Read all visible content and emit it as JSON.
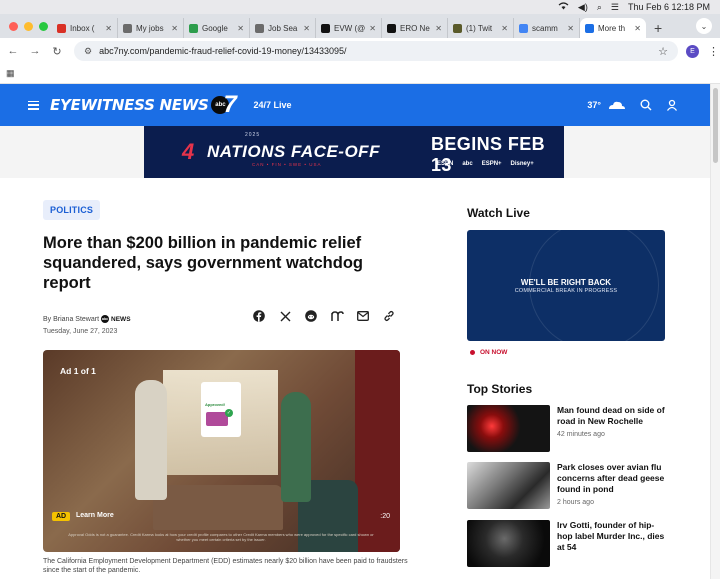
{
  "os_menubar": {
    "datetime": "Thu Feb 6  12:18 PM"
  },
  "browser": {
    "tabs": [
      {
        "label": "Inbox (",
        "favicon": "gmail-icon",
        "color": "#d93025"
      },
      {
        "label": "My jobs",
        "favicon": "job-icon",
        "color": "#6b6b6b"
      },
      {
        "label": "Google",
        "favicon": "google-docs-icon",
        "color": "#2d9d4c"
      },
      {
        "label": "Job Sea",
        "favicon": "job-icon",
        "color": "#6b6b6b"
      },
      {
        "label": "EVW (@",
        "favicon": "x-icon",
        "color": "#111111"
      },
      {
        "label": "ERO Ne",
        "favicon": "x-icon",
        "color": "#111111"
      },
      {
        "label": "(1) Twit",
        "favicon": "twitter-icon",
        "color": "#5a5a2a"
      },
      {
        "label": "scamm",
        "favicon": "google-icon",
        "color": "#4285f4"
      },
      {
        "label": "More th",
        "favicon": "abc-icon",
        "color": "#1b6ee5"
      }
    ],
    "active_tab_index": 8,
    "url": "abc7ny.com/pandemic-fraud-relief-covid-19-money/13433095/",
    "profile_initial": "E"
  },
  "site": {
    "brand": "EYEWITNESS NEWS",
    "station_logo_text": "abc",
    "channel_number": "7",
    "live_label": "24/7 Live",
    "temperature": "37°",
    "colors": {
      "nav": "#1b6ee5",
      "accent_red": "#c8102e"
    }
  },
  "banner_ad": {
    "year": "2025",
    "four": "4",
    "title": "NATIONS FACE-OFF",
    "subtitle": "CAN • FIN • SWE • USA",
    "headline": "BEGINS FEB 13",
    "networks": [
      "ESPN",
      "abc",
      "ESPN+",
      "Disney+"
    ]
  },
  "article": {
    "category": "POLITICS",
    "headline": "More than $200 billion in pandemic relief squandered, says government watchdog report",
    "byline": "By Briana Stewart",
    "byline_logo_text": "abc",
    "byline_brand": "NEWS",
    "date": "Tuesday, June 27, 2023",
    "share_icons": [
      "facebook-icon",
      "x-icon",
      "reddit-icon",
      "threads-icon",
      "email-icon",
      "link-icon"
    ],
    "video_ad": {
      "ad_count": "Ad 1 of 1",
      "badge": "AD",
      "learn_more": "Learn More",
      "duration": ":20",
      "phone_text": "Approved!",
      "disclaimer": "Approval Odds is not a guarantee. Credit Karma looks at how your credit profile compares to other Credit Karma members who were approved for the specific card shown or whether you meet certain criteria set by the issuer."
    },
    "caption": "The California Employment Development Department (EDD) estimates nearly $20 billion have been paid to fraudsters since the start of the pandemic."
  },
  "sidebar": {
    "watch_live_title": "Watch Live",
    "player_message": "WE'LL BE RIGHT BACK",
    "player_submessage": "COMMERCIAL BREAK IN PROGRESS",
    "on_now": "ON NOW",
    "top_stories_title": "Top Stories",
    "stories": [
      {
        "headline": "Man found dead on side of road in New Rochelle",
        "time": "42 minutes ago"
      },
      {
        "headline": "Park closes over avian flu concerns after dead geese found in pond",
        "time": "2 hours ago"
      },
      {
        "headline": "Irv Gotti, founder of hip-hop label Murder Inc., dies at 54",
        "time": ""
      }
    ]
  }
}
